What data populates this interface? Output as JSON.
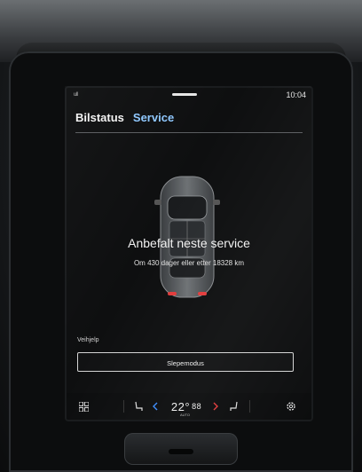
{
  "status_bar": {
    "signal": "ull",
    "clock": "10:04"
  },
  "tabs": [
    {
      "label": "Bilstatus"
    },
    {
      "label": "Service"
    }
  ],
  "service": {
    "title": "Anbefalt neste service",
    "subtitle": "Om 430 dager eller etter 18328 km"
  },
  "roadside": {
    "section_label": "Veihjelp",
    "tow_button": "Slepemodus"
  },
  "climate": {
    "temperature": "22°",
    "fan_symbol": "88",
    "mode": "AUTO"
  },
  "colors": {
    "active_tab": "#8fc8ff",
    "screen_bg": "#0e0f10",
    "hazard_red": "#e23b3b"
  },
  "icons": [
    "home-grid-icon",
    "seat-heat-left-icon",
    "chevron-left-icon",
    "chevron-right-icon",
    "seat-heat-right-icon",
    "settings-gear-icon"
  ]
}
